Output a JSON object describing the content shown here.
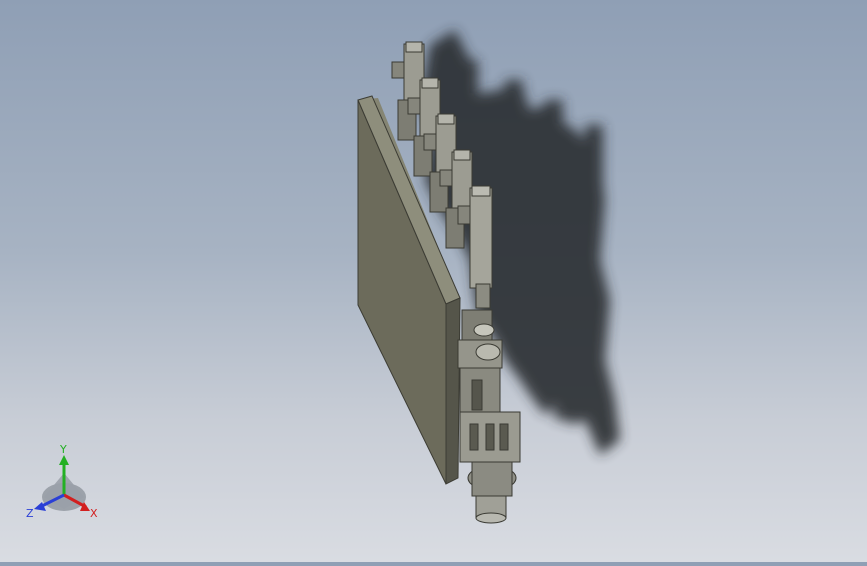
{
  "viewport": {
    "background_top": "#8f9fb5",
    "background_bottom": "#d9dce2",
    "model": {
      "plate_color": "#6f6e5e",
      "plate_edge_color": "#858573",
      "part_color": "#a3a39a",
      "part_dark_color": "#4a4a42",
      "shadow_color": "#2b2d31",
      "cylinder_count": 5
    }
  },
  "triad": {
    "x_label": "X",
    "y_label": "Y",
    "z_label": "Z",
    "x_color": "#d21f1f",
    "y_color": "#23b023",
    "z_color": "#2a3fd6"
  }
}
